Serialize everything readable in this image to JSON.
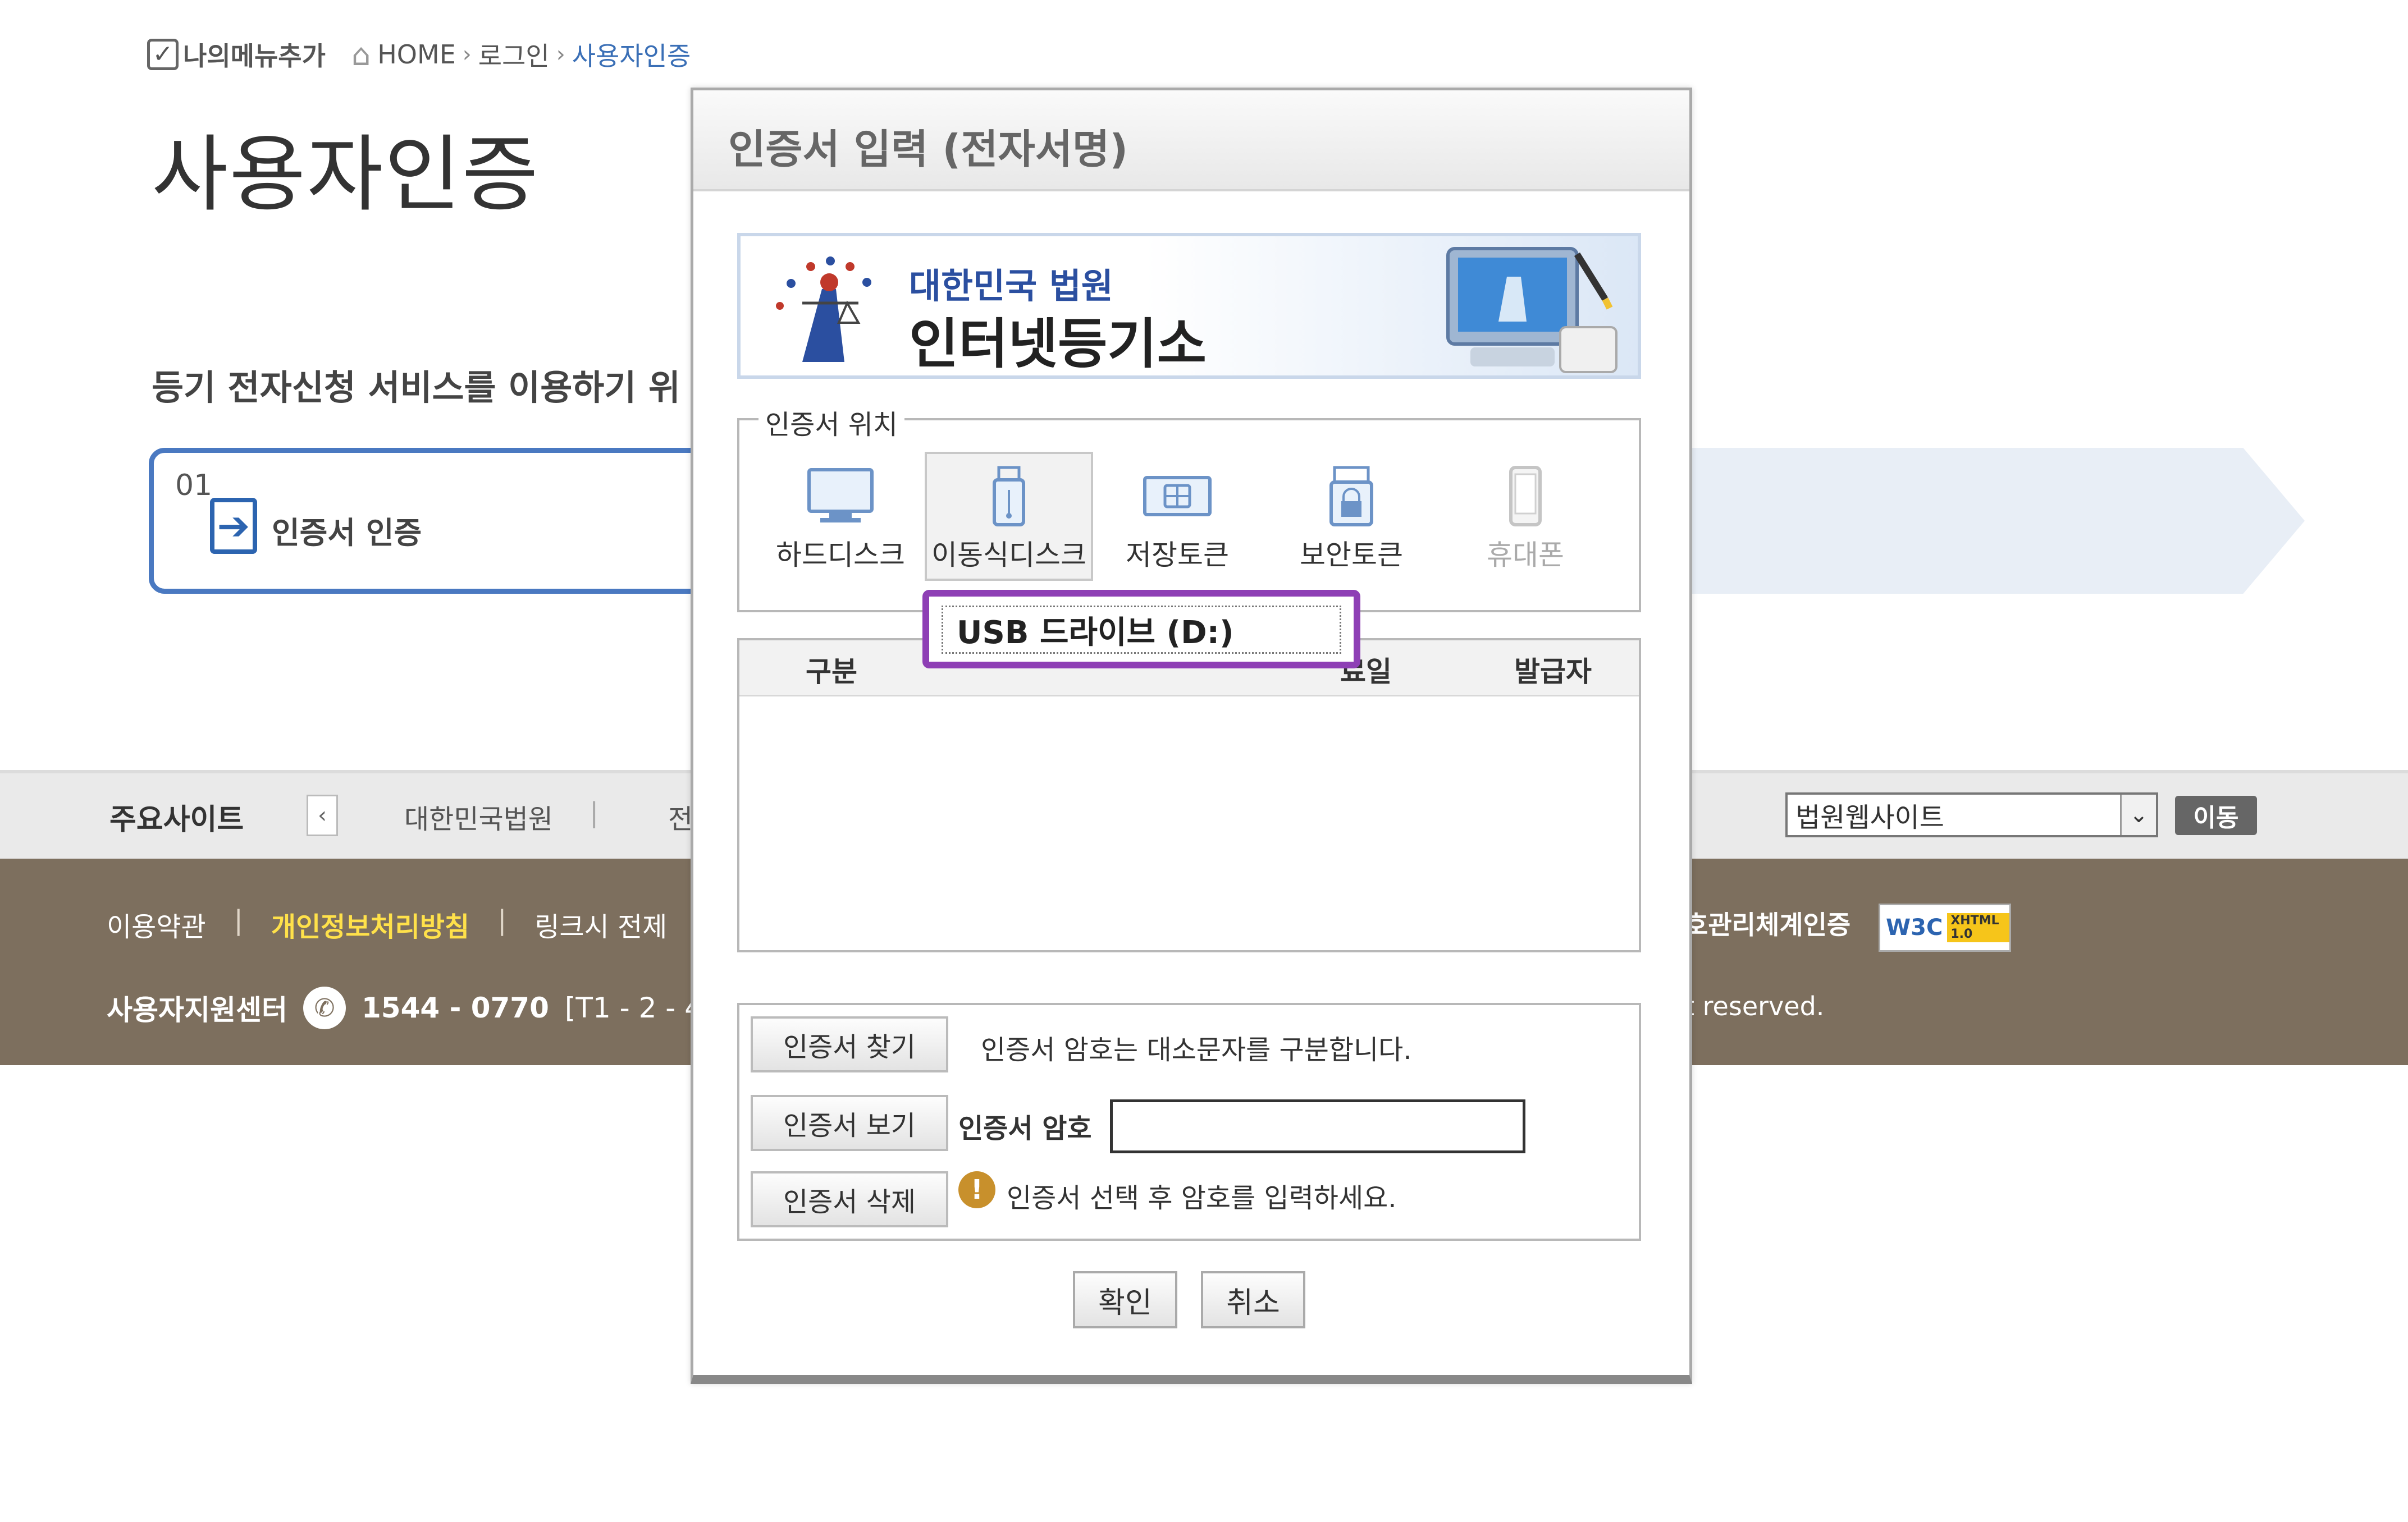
{
  "header": {
    "my_menu": "나의메뉴추가",
    "breadcrumb": [
      "HOME",
      "로그인",
      "사용자인증"
    ]
  },
  "page": {
    "title": "사용자인증",
    "intro": "등기 전자신청 서비스를 이용하기 위",
    "step": {
      "num": "01",
      "label": "인증서 인증"
    }
  },
  "sites": {
    "title": "주요사이트",
    "items": [
      "대한민국법원",
      "|",
      "전"
    ],
    "select_value": "법원웹사이트",
    "go": "이동"
  },
  "footer": {
    "links": [
      "이용약관",
      "|",
      "개인정보처리방침",
      "|",
      "링크시 전제"
    ],
    "center_label": "사용자지원센터",
    "phone": "1544 - 0770",
    "hours": "[T1 - 2 - 4]",
    "cert": "호관리체계인증",
    "w3c": "W3C",
    "w3c_badge": "XHTML 1.0",
    "rights": "t reserved."
  },
  "modal": {
    "title": "인증서 입력 (전자서명)",
    "banner": {
      "court": "대한민국 법원",
      "registry": "인터넷등기소"
    },
    "location_legend": "인증서 위치",
    "locations": [
      {
        "label": "하드디스크",
        "icon": "monitor-icon"
      },
      {
        "label": "이동식디스크",
        "icon": "usb-icon"
      },
      {
        "label": "저장토큰",
        "icon": "token-icon"
      },
      {
        "label": "보안토큰",
        "icon": "lock-icon"
      },
      {
        "label": "휴대폰",
        "icon": "phone-icon"
      }
    ],
    "selected_location": "이동식디스크",
    "table_headers": [
      "구분",
      "",
      "료일",
      "발급자"
    ],
    "dropdown_option": "USB 드라이브 (D:)",
    "buttons": {
      "find": "인증서 찾기",
      "view": "인증서 보기",
      "delete": "인증서 삭제",
      "ok": "확인",
      "cancel": "취소"
    },
    "case_note": "인증서 암호는 대소문자를 구분합니다.",
    "password_label": "인증서 암호",
    "password_value": "",
    "warning": "인증서 선택 후 암호를 입력하세요."
  },
  "colors": {
    "accent": "#4a79c1",
    "footer_bg": "#7d6f5e",
    "dropdown_highlight": "#8e3fb5"
  }
}
